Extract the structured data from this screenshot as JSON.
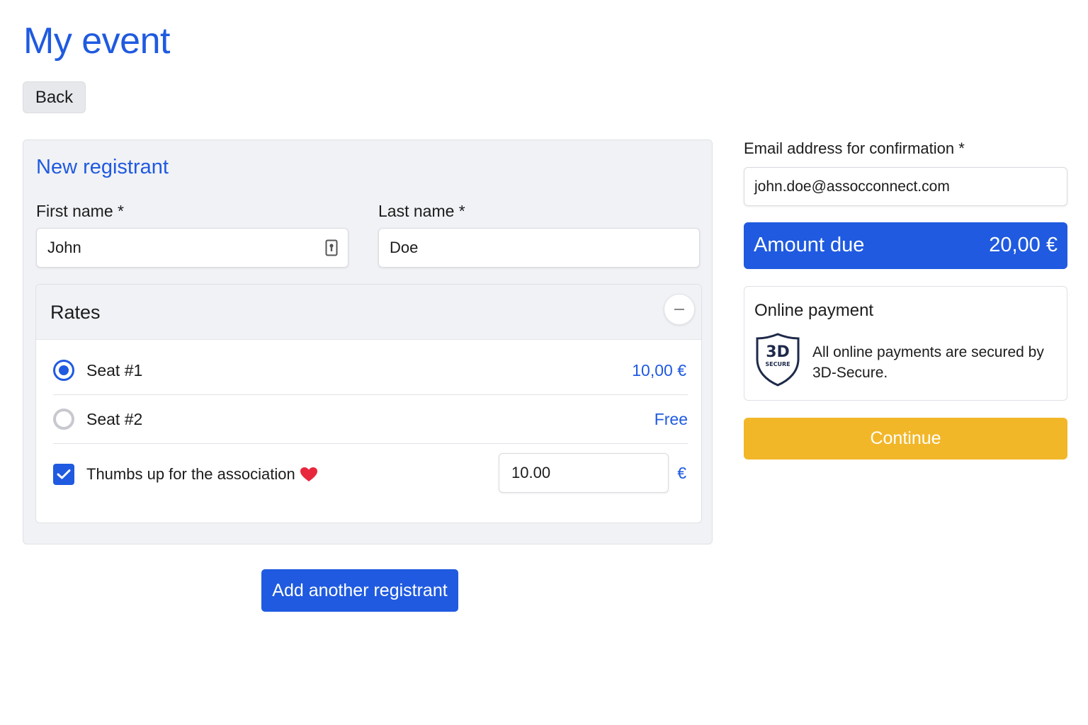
{
  "page": {
    "title": "My event"
  },
  "nav": {
    "back_label": "Back"
  },
  "registrant": {
    "panel_title": "New registrant",
    "first_name": {
      "label": "First name *",
      "value": "John"
    },
    "last_name": {
      "label": "Last  name *",
      "value": "Doe"
    },
    "rates": {
      "title": "Rates",
      "options": [
        {
          "label": "Seat #1",
          "price": "10,00 €",
          "selected": true
        },
        {
          "label": "Seat #2",
          "price": "Free",
          "selected": false
        }
      ],
      "donation": {
        "label": "Thumbs up for the association",
        "checked": true,
        "amount": "10.00",
        "currency": "€",
        "icon": "heart-icon"
      }
    },
    "add_label": "Add another registrant"
  },
  "checkout": {
    "email": {
      "label": "Email address for confirmation *",
      "value": "john.doe@assocconnect.com"
    },
    "amount_due": {
      "label": "Amount due",
      "value": "20,00 €"
    },
    "payment": {
      "title": "Online payment",
      "badge_title": "3D",
      "badge_subtitle": "SECURE",
      "note": "All online payments are secured by 3D-Secure."
    },
    "continue_label": "Continue"
  },
  "colors": {
    "primary": "#1f5ae0",
    "continue": "#f2b728",
    "panel_bg": "#f1f2f5",
    "heart": "#e8273d"
  }
}
